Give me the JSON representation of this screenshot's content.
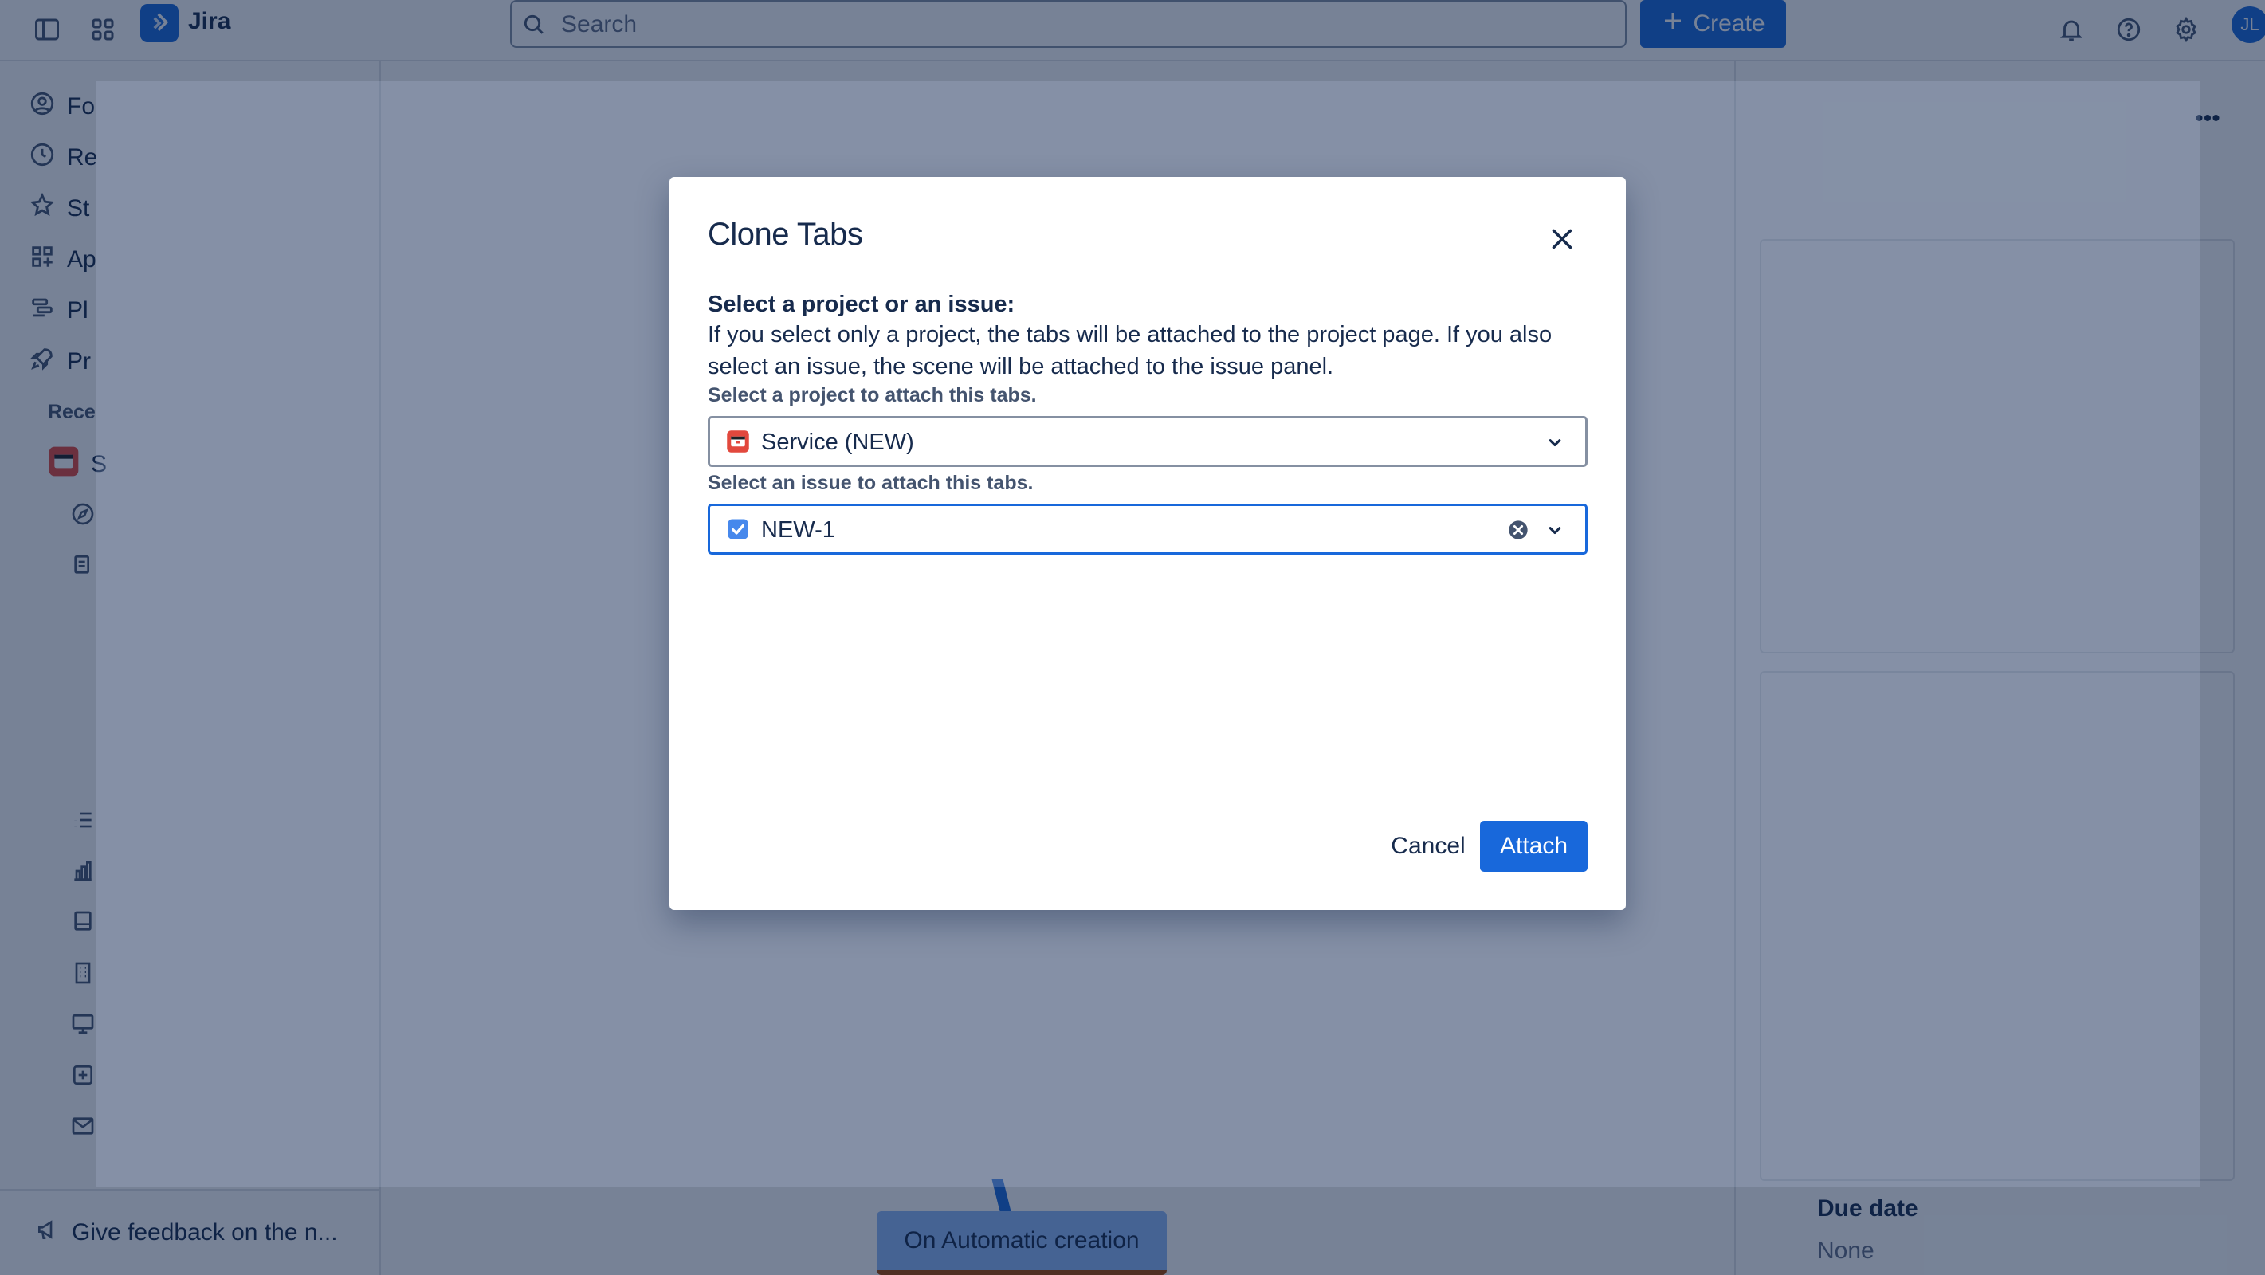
{
  "topbar": {
    "app_name": "Jira",
    "search_placeholder": "Search",
    "create_label": "Create",
    "avatar_initials": "JL"
  },
  "sidebar": {
    "items": [
      {
        "label": "Fo",
        "icon": "person-circle-icon"
      },
      {
        "label": "Re",
        "icon": "clock-icon"
      },
      {
        "label": "St",
        "icon": "star-icon"
      },
      {
        "label": "Ap",
        "icon": "apps-icon"
      },
      {
        "label": "Pl",
        "icon": "plans-icon"
      },
      {
        "label": "Pr",
        "icon": "rocket-icon"
      }
    ],
    "recent_label": "Rece",
    "project_letter": "S",
    "feedback_label": "Give feedback on the n..."
  },
  "main": {
    "flow_node_label": "On Automatic creation"
  },
  "right_panel": {
    "due_date_label": "Due date",
    "due_date_value": "None",
    "more_label": "•••"
  },
  "modal": {
    "title": "Clone Tabs",
    "question_heading": "Select a project or an issue:",
    "question_description": "If you select only a project, the tabs will be attached to the project page. If you also select an issue, the scene will be attached to the issue panel.",
    "project_field": {
      "label": "Select a project to attach this tabs.",
      "value": "Service (NEW)"
    },
    "issue_field": {
      "label": "Select an issue to attach this tabs.",
      "value": "NEW-1"
    },
    "cancel_label": "Cancel",
    "attach_label": "Attach"
  },
  "colors": {
    "primary": "#1868db",
    "text": "#172b4d",
    "subtle_text": "#44546f",
    "overlay": "#091e42",
    "project_icon": "#e2483d"
  }
}
